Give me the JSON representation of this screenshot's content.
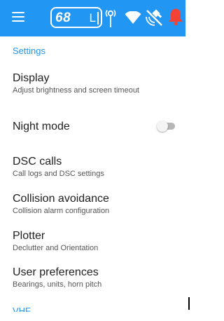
{
  "appbar": {
    "menu_icon": "hamburger-menu-icon",
    "channel": "68",
    "power_level": "L",
    "icons": [
      "antenna-icon",
      "wifi-icon",
      "gps-off-icon",
      "alarm-bell-icon"
    ],
    "colors": {
      "background": "#2196f3",
      "foreground": "#ffffff",
      "bell": "#f44336"
    }
  },
  "settings": {
    "section_header": "Settings",
    "accent_color": "#2196f3",
    "items": [
      {
        "title": "Display",
        "subtitle": "Adjust brightness and screen timeout"
      },
      {
        "title": "Night mode",
        "toggle_on": false
      },
      {
        "title": "DSC calls",
        "subtitle": "Call logs and DSC settings"
      },
      {
        "title": "Collision avoidance",
        "subtitle": "Collision alarm configuration"
      },
      {
        "title": "Plotter",
        "subtitle": "Declutter and Orientation"
      },
      {
        "title": "User preferences",
        "subtitle": "Bearings, units, horn pitch"
      }
    ],
    "next_section_header": "VHF"
  }
}
